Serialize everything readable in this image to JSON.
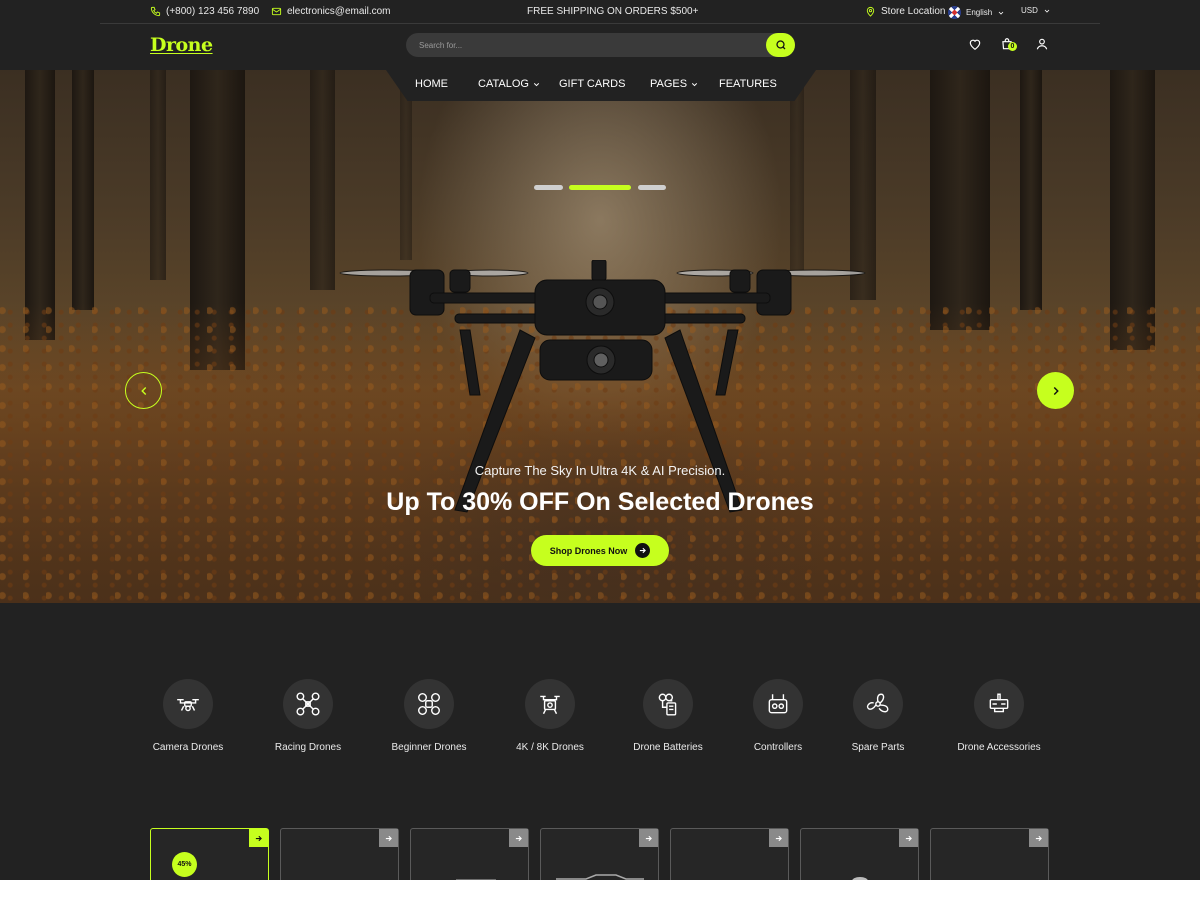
{
  "topbar": {
    "phone": "(+800) 123 456 7890",
    "email": "electronics@email.com",
    "promo": "FREE SHIPPING ON ORDERS $500+",
    "store_location": "Store Location",
    "language": "English",
    "currency": "USD"
  },
  "header": {
    "logo": "Drone",
    "search_placeholder": "Search for...",
    "cart_count": "0"
  },
  "nav": {
    "items": [
      {
        "label": "HOME"
      },
      {
        "label": "CATALOG"
      },
      {
        "label": "GIFT CARDS"
      },
      {
        "label": "PAGES"
      },
      {
        "label": "FEATURES"
      }
    ]
  },
  "hero": {
    "subtitle": "Capture The Sky In Ultra 4K & AI Precision.",
    "title": "Up To 30% OFF On Selected Drones",
    "cta": "Shop Drones Now",
    "active_slide": 2,
    "slide_count": 3
  },
  "categories": [
    {
      "label": "Camera Drones",
      "icon": "camera-drone-icon"
    },
    {
      "label": "Racing Drones",
      "icon": "racing-drone-icon"
    },
    {
      "label": "Beginner Drones",
      "icon": "beginner-drone-icon"
    },
    {
      "label": "4K / 8K Drones",
      "icon": "4k-drone-icon"
    },
    {
      "label": "Drone Batteries",
      "icon": "battery-icon"
    },
    {
      "label": "Controllers",
      "icon": "controller-icon"
    },
    {
      "label": "Spare Parts",
      "icon": "propeller-icon"
    },
    {
      "label": "Drone Accessories",
      "icon": "accessory-icon"
    }
  ],
  "products": {
    "discount_badge": "45%"
  },
  "colors": {
    "accent": "#c6ff1e",
    "background": "#222222"
  }
}
